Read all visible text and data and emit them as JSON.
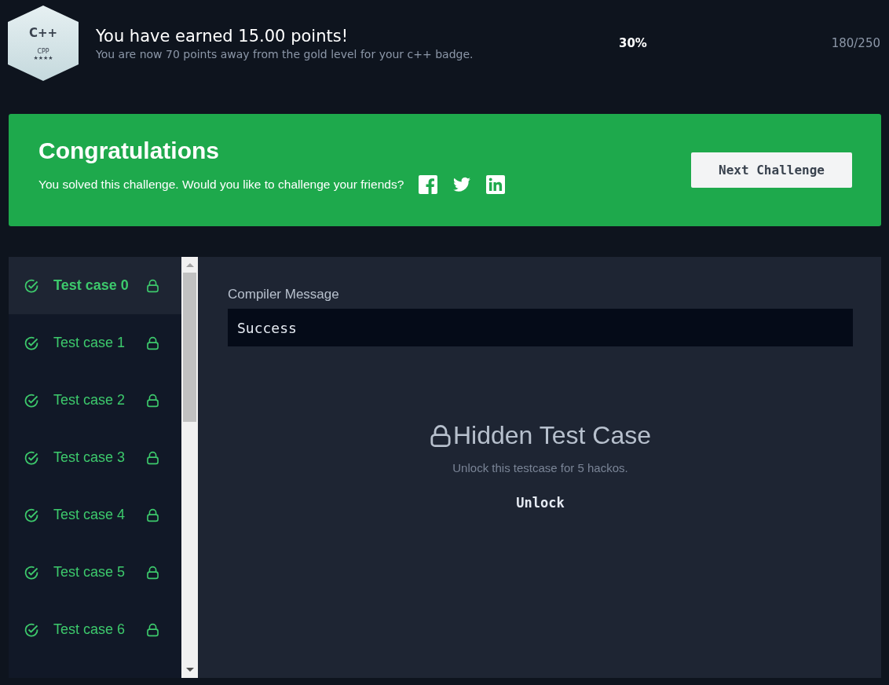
{
  "badge": {
    "logo": "C++",
    "name": "CPP",
    "stars": 4
  },
  "header": {
    "title": "You have earned 15.00 points!",
    "subtitle": "You are now 70 points away from the gold level for your c++ badge.",
    "percent": "30%",
    "score": "180/250"
  },
  "banner": {
    "title": "Congratulations",
    "message": "You solved this challenge. Would you like to challenge your friends?",
    "share": [
      {
        "kind": "facebook"
      },
      {
        "kind": "twitter"
      },
      {
        "kind": "linkedin"
      }
    ],
    "button": "Next Challenge"
  },
  "test_cases": [
    {
      "label": "Test case 0",
      "passed": true,
      "locked": true,
      "selected": true
    },
    {
      "label": "Test case 1",
      "passed": true,
      "locked": true,
      "selected": false
    },
    {
      "label": "Test case 2",
      "passed": true,
      "locked": true,
      "selected": false
    },
    {
      "label": "Test case 3",
      "passed": true,
      "locked": true,
      "selected": false
    },
    {
      "label": "Test case 4",
      "passed": true,
      "locked": true,
      "selected": false
    },
    {
      "label": "Test case 5",
      "passed": true,
      "locked": true,
      "selected": false
    },
    {
      "label": "Test case 6",
      "passed": true,
      "locked": true,
      "selected": false
    }
  ],
  "result": {
    "compiler_label": "Compiler Message",
    "compiler_message": "Success",
    "hidden_title": "Hidden Test Case",
    "hidden_note": "Unlock this testcase for 5 hackos.",
    "unlock_button": "Unlock"
  }
}
